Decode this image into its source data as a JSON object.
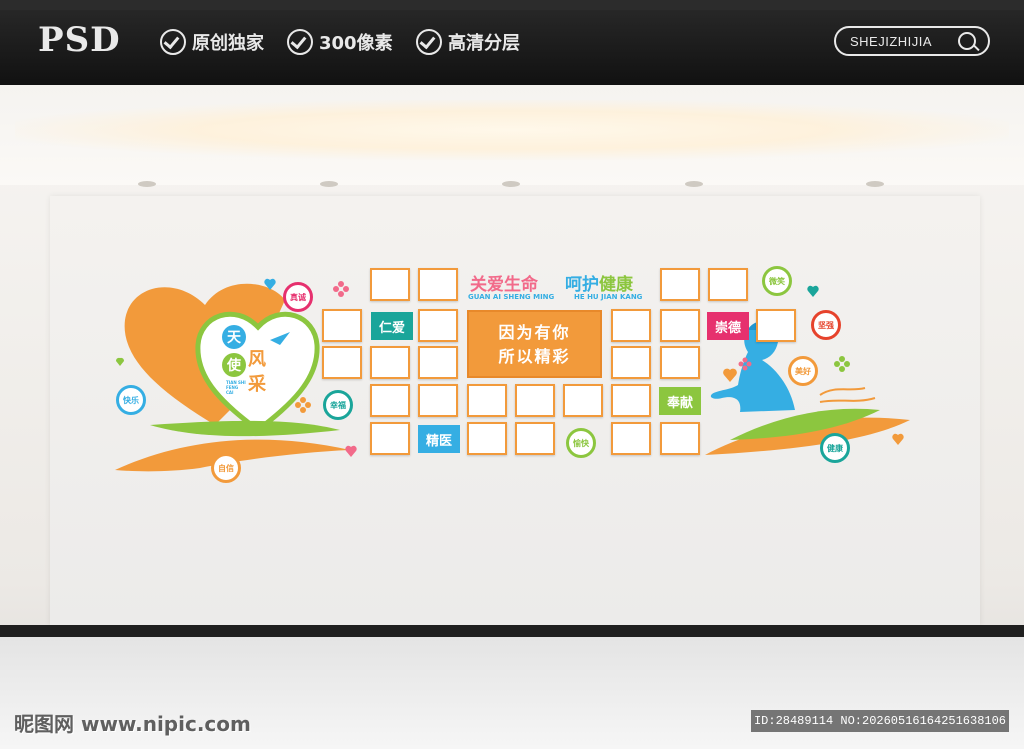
{
  "header": {
    "logo": "PSD",
    "features": [
      "原创独家",
      "300像素",
      "高清分层"
    ],
    "search_text": "SHEJIZHIJIA"
  },
  "wall": {
    "heart_text": [
      "天",
      "使",
      "风",
      "采"
    ],
    "heart_pinyin": "TIAN SHI FENG CAI",
    "title_left": "关爱生命",
    "title_right_1": "呵护",
    "title_right_2": "健康",
    "pinyin_left": "GUAN AI SHENG MING",
    "pinyin_right": "HE HU JIAN KANG",
    "center_line1": "因为有你",
    "center_line2": "所以精彩",
    "tags": [
      "仁爱",
      "崇德",
      "奉献",
      "精医"
    ],
    "circles": [
      "真诚",
      "快乐",
      "自信",
      "幸福",
      "愉快",
      "微笑",
      "坚强",
      "美好",
      "健康"
    ],
    "colors": {
      "orange": "#f29a3b",
      "green": "#8cc63f",
      "teal": "#1aa59a",
      "pink": "#e6306e",
      "blue": "#35aee3",
      "red": "#e6432c"
    }
  },
  "footer": {
    "watermark": "昵图网 www.nipic.com",
    "id_text": "ID:28489114 NO:20260516164251638106"
  }
}
